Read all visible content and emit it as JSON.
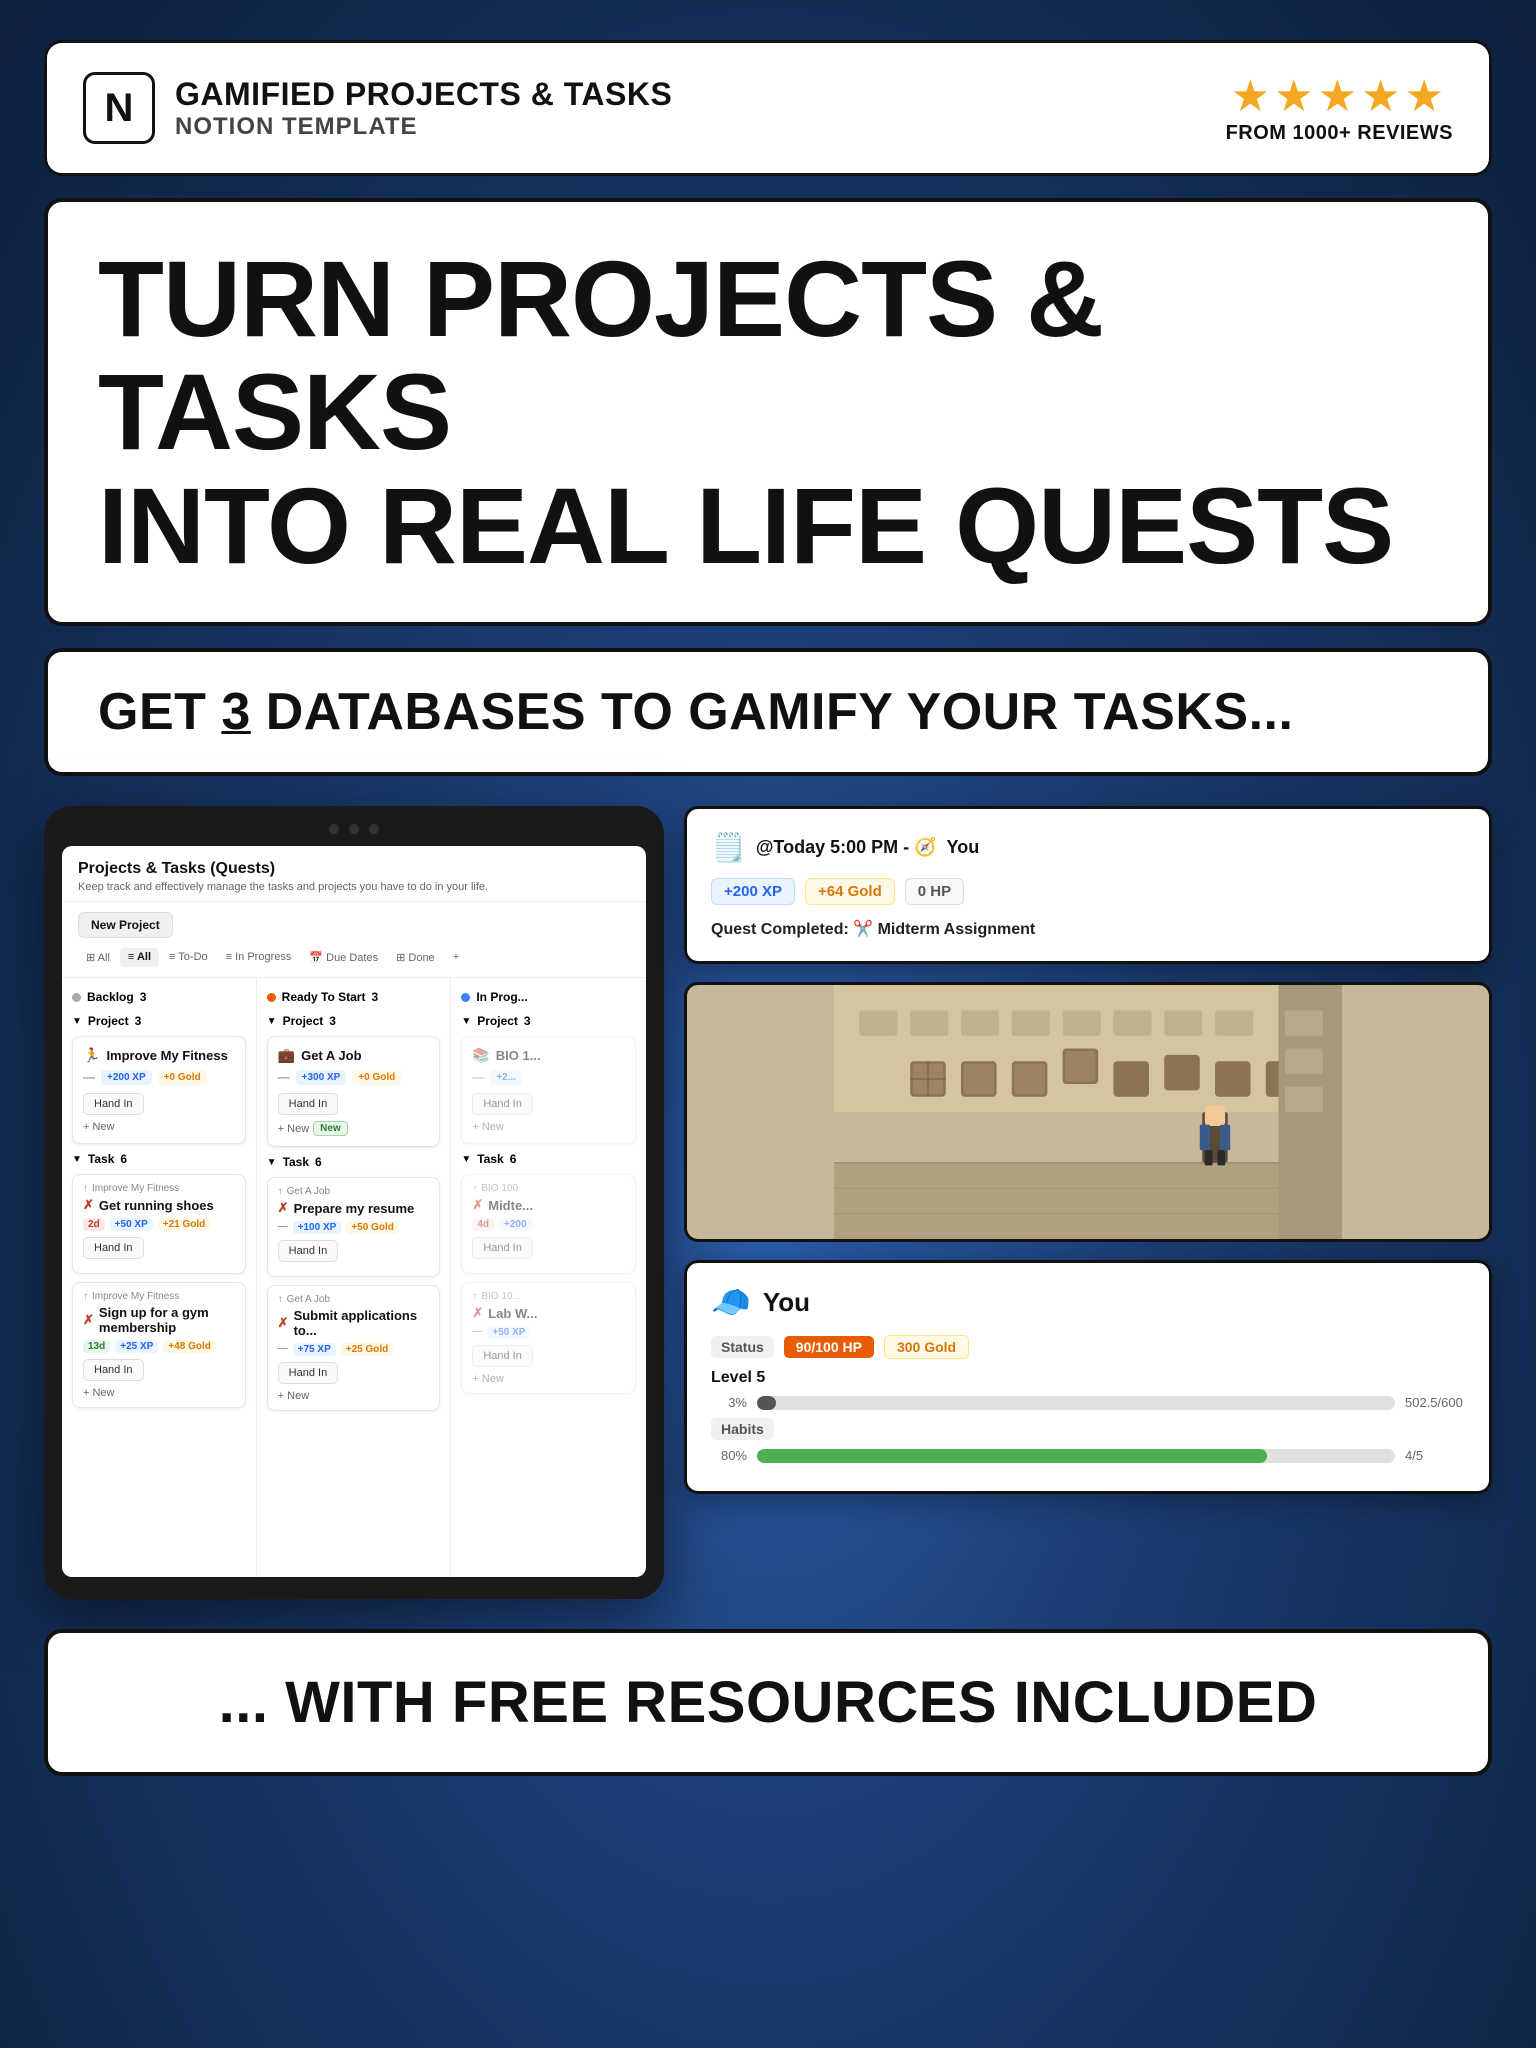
{
  "header": {
    "title": "GAMIFIED PROJECTS & TASKS",
    "subtitle": "NOTION TEMPLATE",
    "stars": "★★★★★",
    "reviews": "FROM 1000+ REVIEWS",
    "notion_icon": "N"
  },
  "hero": {
    "line1": "TURN PROJECTS & TASKS",
    "line2": "INTO REAL LIFE QUESTS"
  },
  "subtitle": {
    "pre": "GET ",
    "number": "3",
    "post": " DATABASES TO GAMIFY YOUR TASKS..."
  },
  "tablet": {
    "title": "Projects & Tasks (Quests)",
    "description": "Keep track and effectively manage the tasks and projects you have to do in your life.",
    "new_project_btn": "New Project",
    "tabs": [
      "All",
      "All",
      "To-Do",
      "In Progress",
      "Due Dates",
      "Done"
    ],
    "active_tab": "All",
    "columns": {
      "backlog": {
        "label": "Backlog",
        "count": 3
      },
      "ready": {
        "label": "Ready To Start",
        "count": 3
      },
      "inprog": {
        "label": "In Prog..."
      }
    },
    "projects": [
      {
        "title": "Improve My Fitness",
        "icon": "🏃",
        "xp": "+200 XP",
        "gold": "+0 Gold",
        "hand_in": "Hand In",
        "new_label": "+ New"
      },
      {
        "title": "Get A Job",
        "icon": "💼",
        "xp": "+300 XP",
        "gold": "+0 Gold",
        "hand_in": "Hand In",
        "new_label": "+ New",
        "new_badge": "New"
      }
    ],
    "tasks_section": "Task",
    "tasks_count": 6,
    "tasks": [
      {
        "parent": "Improve My Fitness",
        "title": "Get running shoes",
        "time": "2d",
        "xp": "+50 XP",
        "gold": "+21 Gold",
        "hand_in": "Hand In"
      },
      {
        "parent": "Get A Job",
        "title": "Prepare my resume",
        "xp": "+100 XP",
        "gold2": "+50 Gold",
        "hand_in": "Hand In"
      },
      {
        "parent": "Improve My Fitness",
        "title": "Sign up for a gym membership",
        "time": "13d",
        "xp": "+25 XP",
        "gold": "+48 Gold",
        "hand_in": "Hand In"
      },
      {
        "parent": "Get A Job",
        "title": "Submit applications to...",
        "xp": "+75 XP",
        "gold2": "+25 Gold",
        "hand_in": "Hand In"
      }
    ]
  },
  "notification": {
    "icon": "🗒️",
    "time": "@Today 5:00 PM - 🧭",
    "you": "You",
    "xp": "+200 XP",
    "gold": "+64 Gold",
    "hp": "0 HP",
    "quest_label": "Quest Completed: ✂️ Midterm Assignment"
  },
  "character": {
    "icon": "🧢",
    "name": "You",
    "status_label": "Status",
    "hp": "90/100 HP",
    "gold": "300 Gold",
    "level": "Level 5",
    "xp_pct": "3%",
    "xp_val": "502.5/600",
    "habits_label": "Habits",
    "habits_pct": "80%",
    "habits_val": "4/5"
  },
  "bottom_banner": "... WITH FREE RESOURCES INCLUDED"
}
